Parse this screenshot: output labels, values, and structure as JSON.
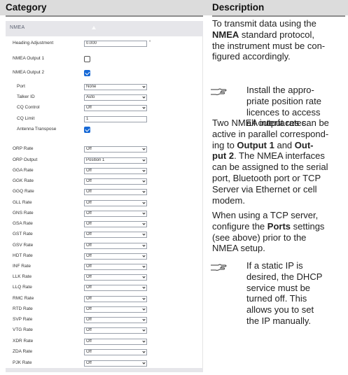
{
  "headers": {
    "category": "Category",
    "description": "Description"
  },
  "panel": {
    "title": "NMEA",
    "rows": [
      {
        "label": "Heading Adjustment",
        "type": "input",
        "value": "0.000",
        "unit": "°"
      },
      {
        "label": "NMEA Output 1",
        "type": "checkbox",
        "checked": false
      },
      {
        "label": "NMEA Output 2",
        "type": "checkbox",
        "checked": true
      },
      {
        "label": "Port",
        "type": "select",
        "value": "None"
      },
      {
        "label": "Talker ID",
        "type": "select",
        "value": "Auto"
      },
      {
        "label": "CQ Control",
        "type": "select",
        "value": "Off"
      },
      {
        "label": "CQ Limit",
        "type": "input",
        "value": "1"
      },
      {
        "label": "Antenna Transpose",
        "type": "checkbox",
        "checked": true
      },
      {
        "label": "ORP Rate",
        "type": "select",
        "value": "Off"
      },
      {
        "label": "ORP Output",
        "type": "select",
        "value": "Position 1"
      },
      {
        "label": "GGA Rate",
        "type": "select",
        "value": "Off"
      },
      {
        "label": "GGK Rate",
        "type": "select",
        "value": "Off"
      },
      {
        "label": "GGQ Rate",
        "type": "select",
        "value": "Off"
      },
      {
        "label": "GLL Rate",
        "type": "select",
        "value": "Off"
      },
      {
        "label": "GNS Rate",
        "type": "select",
        "value": "Off"
      },
      {
        "label": "GSA Rate",
        "type": "select",
        "value": "Off"
      },
      {
        "label": "GST Rate",
        "type": "select",
        "value": "Off"
      },
      {
        "label": "GSV Rate",
        "type": "select",
        "value": "Off"
      },
      {
        "label": "HDT Rate",
        "type": "select",
        "value": "Off"
      },
      {
        "label": "INF Rate",
        "type": "select",
        "value": "Off"
      },
      {
        "label": "LLK Rate",
        "type": "select",
        "value": "Off"
      },
      {
        "label": "LLQ Rate",
        "type": "select",
        "value": "Off"
      },
      {
        "label": "RMC Rate",
        "type": "select",
        "value": "Off"
      },
      {
        "label": "RTD Rate",
        "type": "select",
        "value": "Off"
      },
      {
        "label": "SVP Rate",
        "type": "select",
        "value": "Off"
      },
      {
        "label": "VTG Rate",
        "type": "select",
        "value": "Off"
      },
      {
        "label": "XDR Rate",
        "type": "select",
        "value": "Off"
      },
      {
        "label": "ZDA Rate",
        "type": "select",
        "value": "Off"
      },
      {
        "label": "PJK Rate",
        "type": "select",
        "value": "Off"
      }
    ]
  },
  "description": {
    "p1": {
      "line1": "To transmit data using the",
      "nmea": "NMEA",
      "line2_rest": " standard protocol,",
      "line3": "the instrument must be con-",
      "line4": "figured accordingly."
    },
    "note1": [
      "Install the appro-",
      "priate position rate",
      "licences to access",
      "all output rates."
    ],
    "p2": {
      "l1": "Two NMEA interfaces can be",
      "l2": "active in parallel correspond-",
      "l3_pre": "ing to ",
      "out1": "Output 1",
      "l3_mid": " and ",
      "out_part1": "Out-",
      "out_part2": "put 2",
      "l4_rest": ". The NMEA interfaces",
      "l5": "can be assigned to the serial",
      "l6": "port, Bluetooth port or TCP",
      "l7": "Server via Ethernet or cell",
      "l8": "modem."
    },
    "p3": {
      "l1": "When using a TCP server,",
      "l2_pre": "configure the ",
      "ports": "Ports",
      "l2_rest": " settings",
      "l3": "(see above) prior to the",
      "l4": "NMEA setup."
    },
    "note2": [
      "If a static IP is",
      "desired, the DHCP",
      "service must be",
      "turned off. This",
      "allows you to set",
      "the IP manually."
    ]
  },
  "colors": {
    "header_bg": "#dcdcdc",
    "checkbox_on": "#1769d6",
    "panel_head": "#e6e6ea"
  },
  "icons": {
    "note": "pointing-hand-icon",
    "collapse": "caret-up-icon",
    "select": "chevron-down-icon"
  }
}
